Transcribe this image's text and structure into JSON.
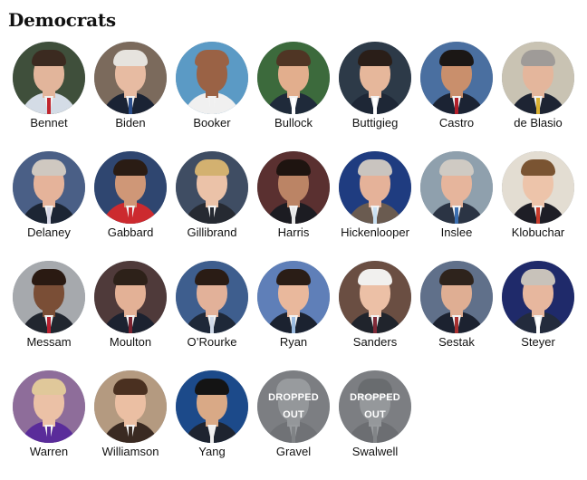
{
  "heading": "Democrats",
  "candidates": [
    {
      "name": "Bennet",
      "bg": "#3f4f3b",
      "skin": "#e2b59b",
      "hair": "#3b2a20",
      "suit": "#d4dce6",
      "tie": "#c0262e",
      "dropped": false
    },
    {
      "name": "Biden",
      "bg": "#7b6a5c",
      "skin": "#e7bba2",
      "hair": "#e6e3de",
      "suit": "#1a2334",
      "tie": "#2c4f8c",
      "dropped": false
    },
    {
      "name": "Booker",
      "bg": "#5b9ac5",
      "skin": "#9a6245",
      "hair": "#9a6245",
      "suit": "#f0f0f0",
      "tie": "#f0f0f0",
      "dropped": false
    },
    {
      "name": "Bullock",
      "bg": "#3c6a3c",
      "skin": "#e2ae8d",
      "hair": "#4f3524",
      "suit": "#1f2a3a",
      "tie": "#ffffff",
      "dropped": false
    },
    {
      "name": "Buttigieg",
      "bg": "#2d3a48",
      "skin": "#e6b79b",
      "hair": "#2a1e18",
      "suit": "#1e2736",
      "tie": "#ffffff",
      "dropped": false
    },
    {
      "name": "Castro",
      "bg": "#4a6fa0",
      "skin": "#c98f6c",
      "hair": "#1b1715",
      "suit": "#1b2333",
      "tie": "#b31f2a",
      "dropped": false
    },
    {
      "name": "de Blasio",
      "bg": "#c9c3b3",
      "skin": "#e4b69c",
      "hair": "#9f9b98",
      "suit": "#1d2433",
      "tie": "#d9b031",
      "dropped": false
    },
    {
      "name": "Delaney",
      "bg": "#4a5f86",
      "skin": "#e5b39a",
      "hair": "#cfc8c0",
      "suit": "#1c2534",
      "tie": "#d8d8e8",
      "dropped": false
    },
    {
      "name": "Gabbard",
      "bg": "#2f4670",
      "skin": "#cf9777",
      "hair": "#2a1c14",
      "suit": "#cc2a2f",
      "tie": "#cc2a2f",
      "dropped": false
    },
    {
      "name": "Gillibrand",
      "bg": "#3f4d63",
      "skin": "#ebc2a8",
      "hair": "#d3b170",
      "suit": "#262a32",
      "tie": "#262a32",
      "dropped": false
    },
    {
      "name": "Harris",
      "bg": "#5a3030",
      "skin": "#bb8465",
      "hair": "#1e1410",
      "suit": "#1c1c22",
      "tie": "#e8e8e8",
      "dropped": false
    },
    {
      "name": "Hickenlooper",
      "bg": "#1f3c80",
      "skin": "#e5b299",
      "hair": "#c9c4bf",
      "suit": "#6a5b50",
      "tie": "#c9e0f2",
      "dropped": false
    },
    {
      "name": "Inslee",
      "bg": "#8fa0ad",
      "skin": "#e6b59c",
      "hair": "#cfcac3",
      "suit": "#2b3444",
      "tie": "#3c6fb0",
      "dropped": false
    },
    {
      "name": "Klobuchar",
      "bg": "#e3ddd2",
      "skin": "#edc4aa",
      "hair": "#7a5432",
      "suit": "#1e1e26",
      "tie": "#c83b2b",
      "dropped": false
    },
    {
      "name": "Messam",
      "bg": "#a6a9ad",
      "skin": "#7a4e36",
      "hair": "#2a1a12",
      "suit": "#21262f",
      "tie": "#b72030",
      "dropped": false
    },
    {
      "name": "Moulton",
      "bg": "#4f3a3a",
      "skin": "#e3b196",
      "hair": "#2d2119",
      "suit": "#1c2230",
      "tie": "#7b2330",
      "dropped": false
    },
    {
      "name": "O’Rourke",
      "bg": "#3e5e8e",
      "skin": "#e2b199",
      "hair": "#2a1c15",
      "suit": "#1e2838",
      "tie": "#cfd9e8",
      "dropped": false
    },
    {
      "name": "Ryan",
      "bg": "#5f7fb8",
      "skin": "#e9b89c",
      "hair": "#2a1d16",
      "suit": "#1b2230",
      "tie": "#9bbbe0",
      "dropped": false
    },
    {
      "name": "Sanders",
      "bg": "#6a4e42",
      "skin": "#ecc0a6",
      "hair": "#f1f0ee",
      "suit": "#20242c",
      "tie": "#7f2a38",
      "dropped": false
    },
    {
      "name": "Sestak",
      "bg": "#60708a",
      "skin": "#dfae93",
      "hair": "#2e231c",
      "suit": "#1c2230",
      "tie": "#a83030",
      "dropped": false
    },
    {
      "name": "Steyer",
      "bg": "#1f2a6a",
      "skin": "#e7b79e",
      "hair": "#c8c2ba",
      "suit": "#232b3c",
      "tie": "#ffffff",
      "dropped": false
    },
    {
      "name": "Warren",
      "bg": "#8e6d9a",
      "skin": "#ebc1a6",
      "hair": "#e0c89a",
      "suit": "#5a2c9a",
      "tie": "#5a2c9a",
      "dropped": false
    },
    {
      "name": "Williamson",
      "bg": "#b49a80",
      "skin": "#ebbfa3",
      "hair": "#4a3020",
      "suit": "#3a2a22",
      "tie": "#3a2a22",
      "dropped": false
    },
    {
      "name": "Yang",
      "bg": "#1c4a8a",
      "skin": "#d9a986",
      "hair": "#141414",
      "suit": "#1e2430",
      "tie": "#f0f0f0",
      "dropped": false
    },
    {
      "name": "Gravel",
      "bg": "#8d8d8d",
      "skin": "#d2d2d2",
      "hair": "#f0f0f0",
      "suit": "#6a6a6a",
      "tie": "#9a9a9a",
      "dropped": true,
      "status": [
        "DROPPED",
        "OUT"
      ]
    },
    {
      "name": "Swalwell",
      "bg": "#8d8d8d",
      "skin": "#d6d6d6",
      "hair": "#585858",
      "suit": "#5f5f5f",
      "tie": "#a0a0a0",
      "dropped": true,
      "status": [
        "DROPPED",
        "OUT"
      ]
    }
  ]
}
